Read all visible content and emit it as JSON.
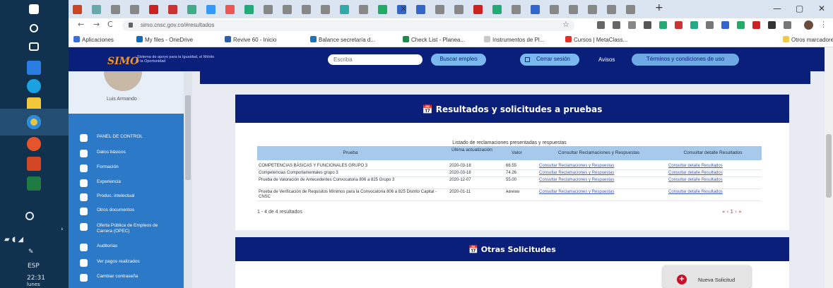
{
  "browser": {
    "url": "simo.cnsc.gov.co/#resultados",
    "tab_new_label": "+",
    "win_min": "—",
    "win_max": "▢",
    "win_close": "✕",
    "nav_back": "←",
    "nav_forward": "→",
    "nav_reload": "C",
    "bookmarks": [
      {
        "label": "Aplicaciones",
        "color": "#3a6fd8"
      },
      {
        "label": "My files - OneDrive",
        "color": "#0f6cbd"
      },
      {
        "label": "Revive 60 - Inicio",
        "color": "#2f5da8"
      },
      {
        "label": "Balance secretaría d...",
        "color": "#1b73b8"
      },
      {
        "label": "Check List - Planea...",
        "color": "#1f8a4c"
      },
      {
        "label": "Instrumentos de Pl...",
        "color": "#c9c9c9"
      },
      {
        "label": "Cursos | MetaClass...",
        "color": "#e0342b"
      },
      {
        "label": "Otros marcadores",
        "color": "#f2c94c"
      }
    ]
  },
  "header": {
    "logo": "SIMO",
    "logo_tagline": "Sistema de apoyo para la Igualdad, el Mérito y la Oportunidad",
    "search_placeholder": "Escriba",
    "search_jobs": "Buscar empleo",
    "login": "Cerrar sesión",
    "notices": "Avisos",
    "terms": "Términos y condiciones de uso"
  },
  "sidebar": {
    "user_name": "Luis Armando",
    "items": [
      {
        "label": "PANEL DE CONTROL",
        "icon": "dashboard-icon"
      },
      {
        "label": "Datos básicos",
        "icon": "user-data-icon"
      },
      {
        "label": "Formación",
        "icon": "graduation-icon"
      },
      {
        "label": "Experiencia",
        "icon": "briefcase-icon"
      },
      {
        "label": "Produc. intelectual",
        "icon": "book-icon"
      },
      {
        "label": "Otros documentos",
        "icon": "document-icon"
      },
      {
        "label": "Oferta Pública de Empleos de Carrera (OPEC)",
        "icon": "globe-icon"
      },
      {
        "label": "Auditorías",
        "icon": "audit-icon"
      },
      {
        "label": "Ver pagos realizados",
        "icon": "payment-icon"
      },
      {
        "label": "Cambiar contraseña",
        "icon": "key-icon"
      }
    ]
  },
  "results": {
    "title": "📅 Resultados y solicitudes a pruebas",
    "table_caption": "Listado de reclamaciones presentadas y respuestas",
    "columns": [
      "Prueba",
      "Última actualización",
      "Valor",
      "Consultar Reclamaciones y Respuestas",
      "Consultar detalle Resultados"
    ],
    "rows": [
      {
        "prueba": "COMPETENCIAS BÁSICAS Y FUNCIONALES GRUPO 3",
        "fecha": "2020-03-18",
        "valor": "66.55",
        "reclamaciones": "Consultar Reclamaciones y Respuestas",
        "detalle": "Consultar detalle Resultados"
      },
      {
        "prueba": "Competencias Comportamentales grupo 3",
        "fecha": "2020-03-18",
        "valor": "74.26",
        "reclamaciones": "Consultar Reclamaciones y Respuestas",
        "detalle": "Consultar detalle Resultados"
      },
      {
        "prueba": "Prueba de Valoración de Antecedentes Convocatoria 806 a 825 Grupo 3",
        "fecha": "2020-12-07",
        "valor": "55.00",
        "reclamaciones": "Consultar Reclamaciones y Respuestas",
        "detalle": "Consultar detalle Resultados"
      },
      {
        "prueba": "Prueba de Verificación de Requisitos Mínimos para la Convocatoria 806 a 825 Distrito Capital - CNSC",
        "fecha": "2020-01-11",
        "valor": "Admitido",
        "reclamaciones": "Consultar Reclamaciones y Respuestas",
        "detalle": "Consultar detalle Resultados"
      }
    ],
    "pager_info": "1 - 4 de 4 resultados",
    "pager": "« ‹ 1 › »"
  },
  "other": {
    "title": "📅 Otras Solicitudes",
    "new_request": "Nueva Solicitud",
    "new_request_icon": "+"
  },
  "taskbar": {
    "tray_lang": "ESP",
    "tray_time": "22:31",
    "tray_date": "lunes"
  }
}
